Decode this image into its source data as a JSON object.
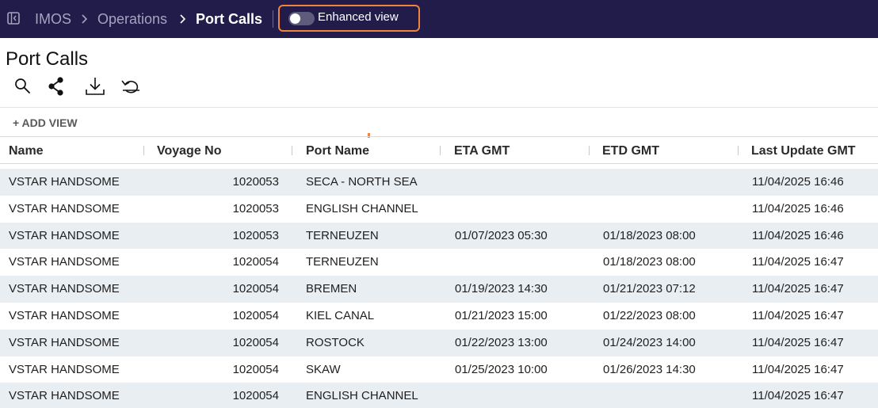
{
  "topbar": {
    "breadcrumbs": [
      "IMOS",
      "Operations",
      "Port Calls"
    ],
    "enhanced_view": {
      "label": "Enhanced view",
      "enabled": false
    }
  },
  "page": {
    "title": "Port Calls",
    "toolbar_icons": [
      "search-icon",
      "share-icon",
      "download-icon",
      "undo-icon"
    ],
    "add_view_label": "+ ADD VIEW"
  },
  "table": {
    "columns": [
      "Name",
      "Voyage No",
      "Port Name",
      "ETA GMT",
      "ETD GMT",
      "Last Update GMT"
    ],
    "rows": [
      [
        "VSTAR HANDSOME",
        "1020053",
        "SECA - NORTH SEA",
        "",
        "",
        "11/04/2025 16:46"
      ],
      [
        "VSTAR HANDSOME",
        "1020053",
        "ENGLISH CHANNEL",
        "",
        "",
        "11/04/2025 16:46"
      ],
      [
        "VSTAR HANDSOME",
        "1020053",
        "TERNEUZEN",
        "01/07/2023 05:30",
        "01/18/2023 08:00",
        "11/04/2025 16:46"
      ],
      [
        "VSTAR HANDSOME",
        "1020054",
        "TERNEUZEN",
        "",
        "01/18/2023 08:00",
        "11/04/2025 16:47"
      ],
      [
        "VSTAR HANDSOME",
        "1020054",
        "BREMEN",
        "01/19/2023 14:30",
        "01/21/2023 07:12",
        "11/04/2025 16:47"
      ],
      [
        "VSTAR HANDSOME",
        "1020054",
        "KIEL CANAL",
        "01/21/2023 15:00",
        "01/22/2023 08:00",
        "11/04/2025 16:47"
      ],
      [
        "VSTAR HANDSOME",
        "1020054",
        "ROSTOCK",
        "01/22/2023 13:00",
        "01/24/2023 14:00",
        "11/04/2025 16:47"
      ],
      [
        "VSTAR HANDSOME",
        "1020054",
        "SKAW",
        "01/25/2023 10:00",
        "01/26/2023 14:30",
        "11/04/2025 16:47"
      ],
      [
        "VSTAR HANDSOME",
        "1020054",
        "ENGLISH CHANNEL",
        "",
        "",
        "11/04/2025 16:47"
      ]
    ]
  },
  "colors": {
    "topbar_bg": "#211c4a",
    "highlight": "#f0843a",
    "row_shade": "#e8eef2"
  }
}
